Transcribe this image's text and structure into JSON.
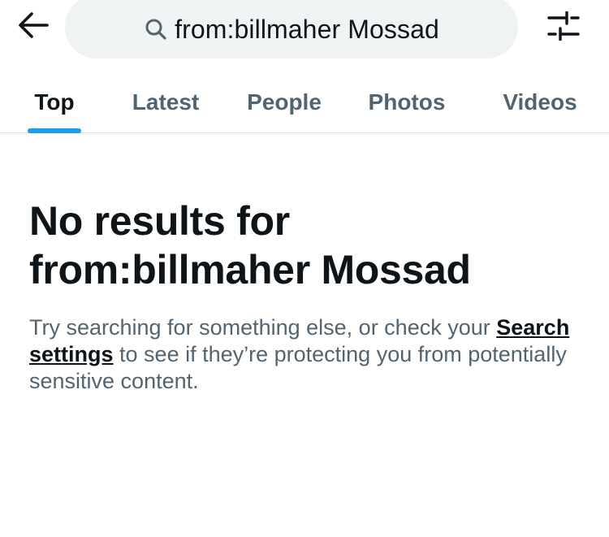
{
  "header": {
    "back_icon": "arrow-left-icon",
    "search_icon": "search-icon",
    "search_query": "from:billmaher Mossad",
    "filter_icon": "sliders-icon"
  },
  "tabs": [
    {
      "label": "Top",
      "active": true
    },
    {
      "label": "Latest",
      "active": false
    },
    {
      "label": "People",
      "active": false
    },
    {
      "label": "Photos",
      "active": false
    },
    {
      "label": "Videos",
      "active": false
    }
  ],
  "empty_state": {
    "heading_prefix": "No results for",
    "heading_query": "from:billmaher Mossad",
    "message_before": "Try searching for something else, or check your ",
    "link_text": "Search settings",
    "message_after": " to see if they’re protecting you from potentially sensitive content."
  },
  "colors": {
    "accent": "#1d9bf0",
    "text_primary": "#0f1419",
    "text_secondary": "#536471",
    "search_bg": "#eff3f4"
  }
}
